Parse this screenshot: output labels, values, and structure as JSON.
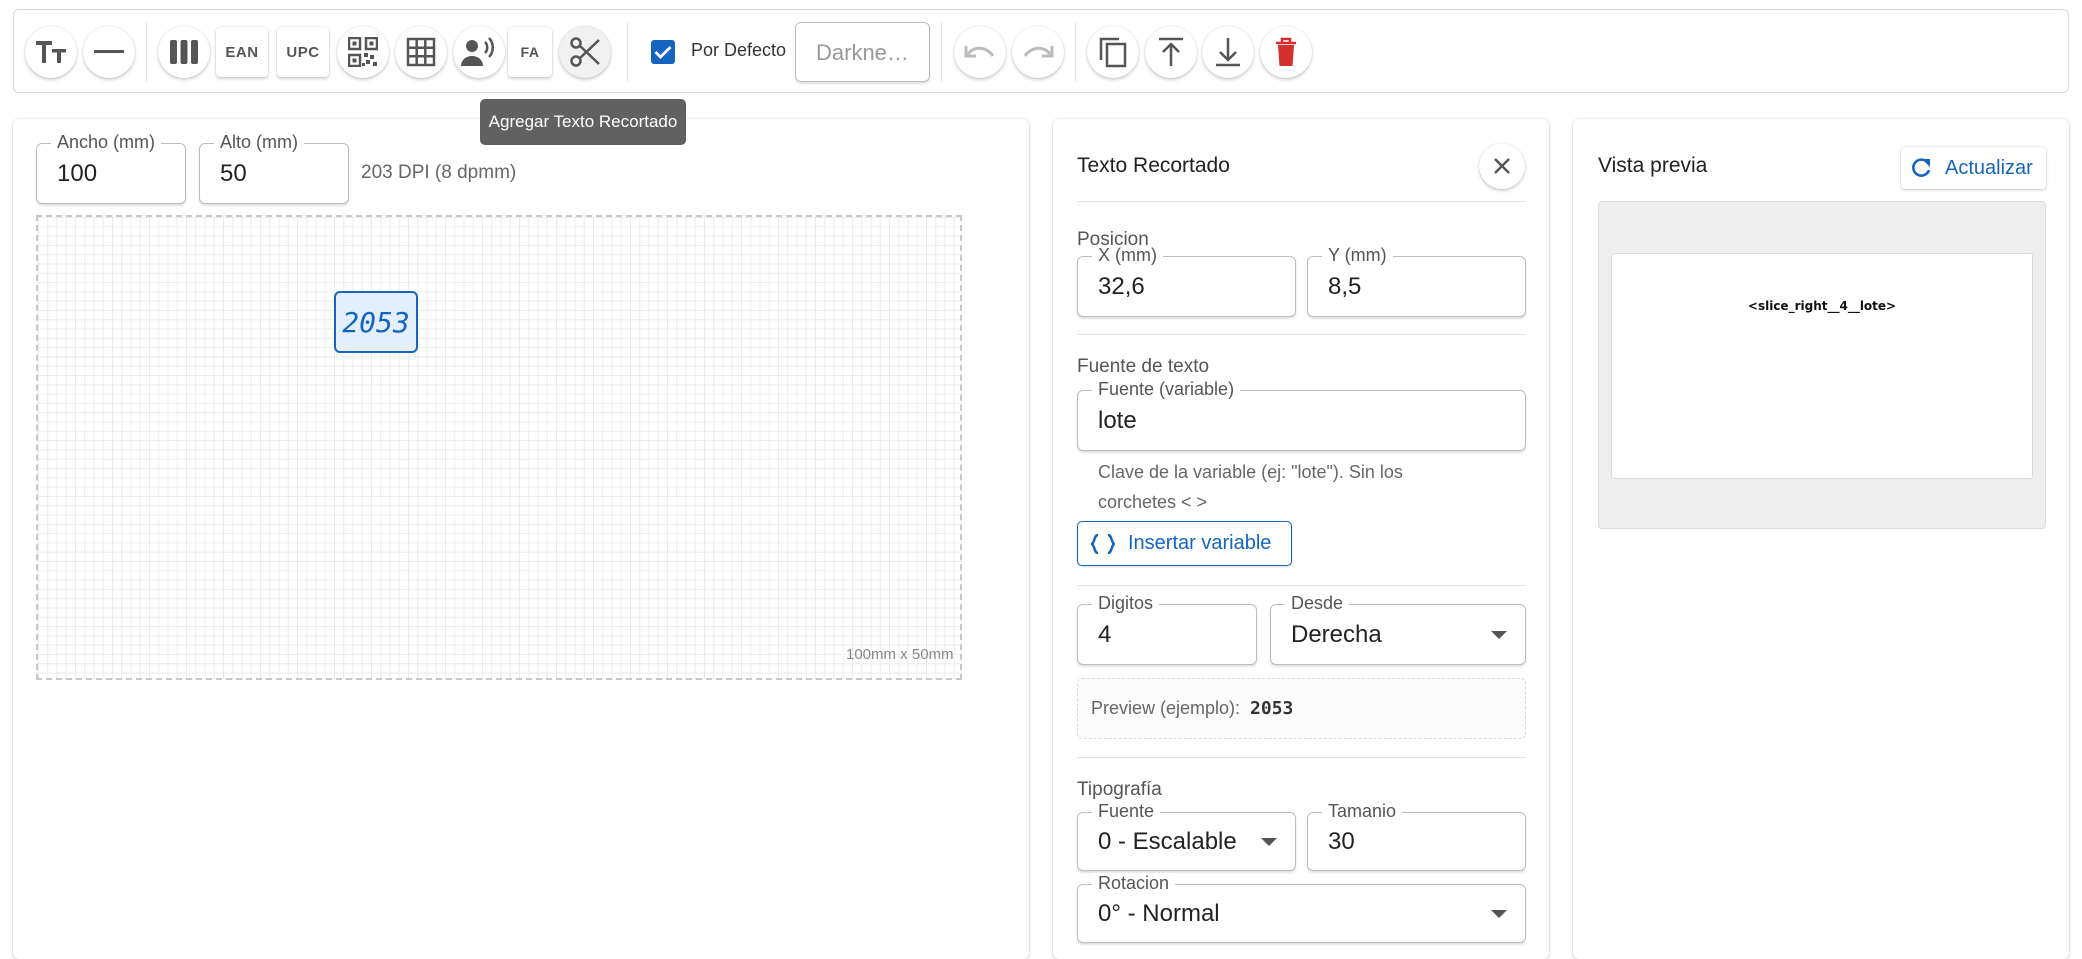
{
  "toolbar": {
    "ean_label": "EAN",
    "upc_label": "UPC",
    "fa_label": "FA",
    "default_checkbox_label": "Por Defecto",
    "default_checked": true,
    "printer_placeholder": "Darkne…",
    "tooltip": "Agregar Texto Recortado"
  },
  "label_settings": {
    "width_label": "Ancho (mm)",
    "width_value": "100",
    "height_label": "Alto (mm)",
    "height_value": "50",
    "dpi_text": "203 DPI (8 dpmm)"
  },
  "canvas": {
    "element_text": "2053",
    "size_text": "100mm x 50mm"
  },
  "properties": {
    "title": "Texto Recortado",
    "position_title": "Posicion",
    "x_label": "X (mm)",
    "x_value": "32,6",
    "y_label": "Y (mm)",
    "y_value": "8,5",
    "source_title": "Fuente de texto",
    "source_label": "Fuente (variable)",
    "source_value": "lote",
    "source_help": "Clave de la variable (ej: \"lote\"). Sin los corchetes < >",
    "insert_variable_label": "Insertar variable",
    "digits_label": "Digitos",
    "digits_value": "4",
    "from_label": "Desde",
    "from_value": "Derecha",
    "preview_label": "Preview (ejemplo):",
    "preview_value": "2053",
    "typography_title": "Tipografía",
    "font_label": "Fuente",
    "font_value": "0 - Escalable",
    "size_label": "Tamanio",
    "size_value": "30",
    "rotation_label": "Rotacion",
    "rotation_value": "0° - Normal"
  },
  "preview_panel": {
    "title": "Vista previa",
    "refresh_label": "Actualizar",
    "preview_text": "<slice_right__4__lote>"
  },
  "colors": {
    "accent": "#1565c0",
    "delete": "#d32f2f",
    "tooltip_bg": "#616161",
    "element_bg": "#e3f0fb"
  }
}
